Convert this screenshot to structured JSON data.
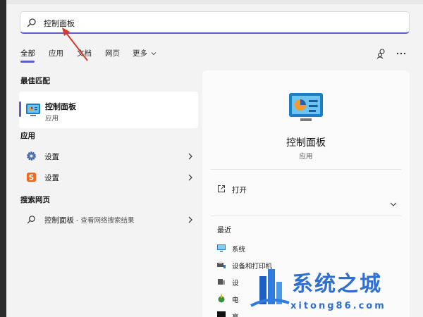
{
  "search": {
    "query": "控制面板"
  },
  "tabs": [
    {
      "label": "全部"
    },
    {
      "label": "应用"
    },
    {
      "label": "文档"
    },
    {
      "label": "网页"
    },
    {
      "label": "更多"
    }
  ],
  "top_icons": [
    "account-switch-icon",
    "more-options-icon"
  ],
  "sections": {
    "best_match": "最佳匹配",
    "apps": "应用",
    "web": "搜索网页"
  },
  "best_match": {
    "name": "控制面板",
    "type": "应用",
    "icon": "control-panel-icon"
  },
  "apps": [
    {
      "label": "设置",
      "icon": "gear-icon"
    },
    {
      "label": "设置",
      "icon": "sogou-icon"
    }
  ],
  "web_result": {
    "label": "控制面板",
    "sub": " - 查看网络搜索结果",
    "icon": "search-icon"
  },
  "detail": {
    "title": "控制面板",
    "type": "应用",
    "open_label": "打开",
    "recent_label": "最近",
    "recent_items": [
      {
        "label": "系统",
        "icon": "monitor-icon"
      },
      {
        "label": "设备和打印机",
        "icon": "printer-icon"
      },
      {
        "label": "设",
        "icon": "device-icon"
      },
      {
        "label": "电",
        "icon": "power-icon"
      },
      {
        "label": "高",
        "icon": "black-square-icon"
      }
    ]
  },
  "watermark": {
    "brand": "系统之城",
    "url": "xitong86.com"
  },
  "colors": {
    "accent": "#5b5fc7",
    "annotation": "#d63b2f",
    "watermark": "#2f6fd1"
  }
}
